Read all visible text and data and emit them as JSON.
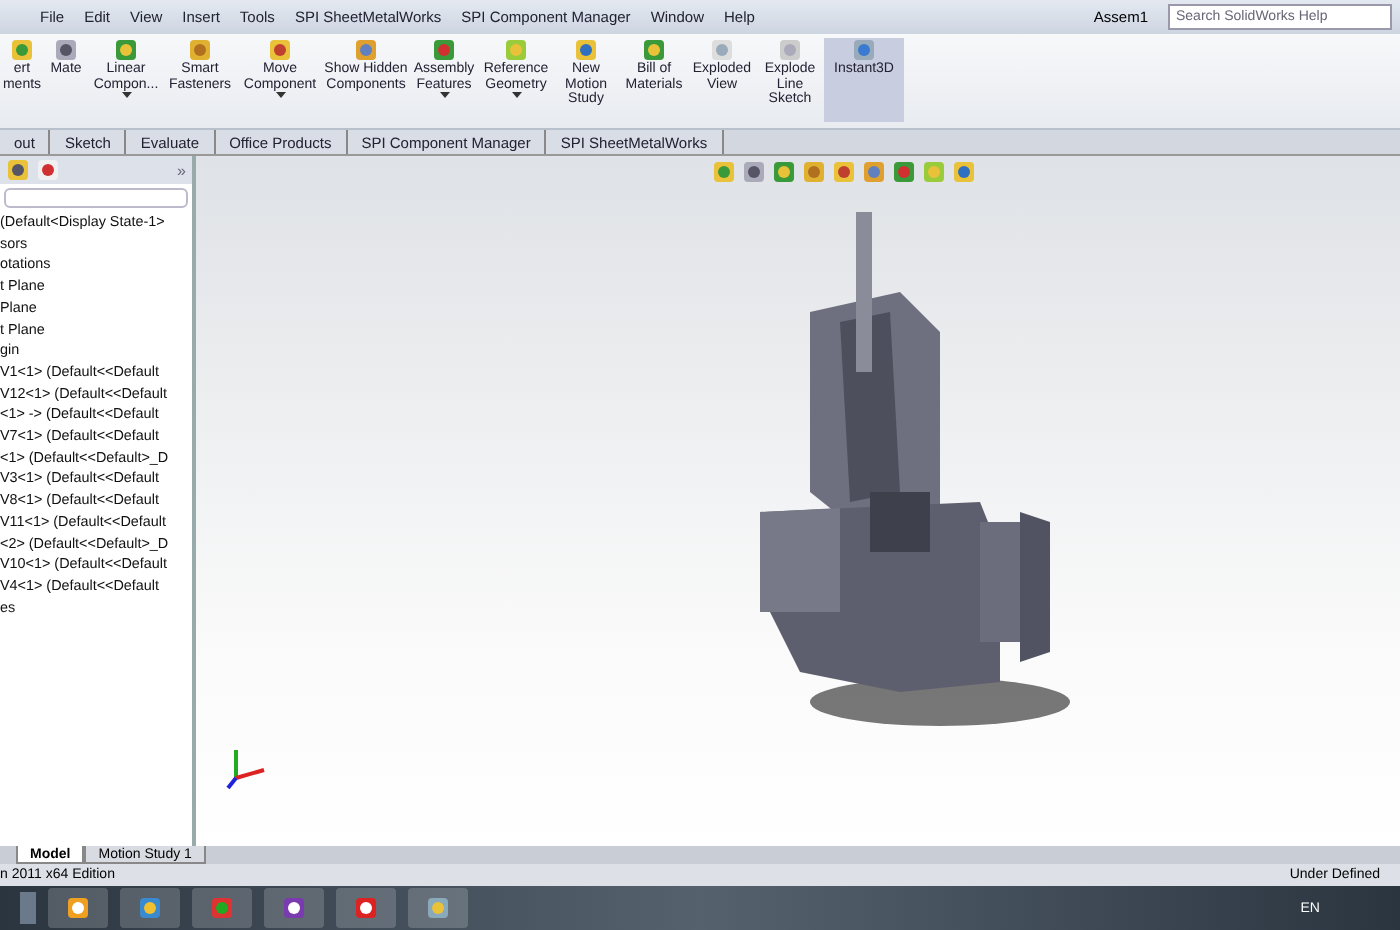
{
  "menu_bar": {
    "items": [
      "File",
      "Edit",
      "View",
      "Insert",
      "Tools",
      "SPI SheetMetalWorks",
      "SPI Component Manager",
      "Window",
      "Help"
    ],
    "document_title": "Assem1",
    "search": {
      "placeholder": "Search SolidWorks Help"
    }
  },
  "command_manager": {
    "buttons": [
      {
        "label": "ert ments",
        "dropdown": false
      },
      {
        "label": "Mate",
        "dropdown": false
      },
      {
        "label": "Linear Compon...",
        "dropdown": true
      },
      {
        "label": "Smart Fasteners",
        "dropdown": false
      },
      {
        "label": "Move Component",
        "dropdown": true
      },
      {
        "label": "Show Hidden Components",
        "dropdown": false
      },
      {
        "label": "Assembly Features",
        "dropdown": true
      },
      {
        "label": "Reference Geometry",
        "dropdown": true
      },
      {
        "label": "New Motion Study",
        "dropdown": false
      },
      {
        "label": "Bill of Materials",
        "dropdown": false
      },
      {
        "label": "Exploded View",
        "dropdown": false
      },
      {
        "label": "Explode Line Sketch",
        "dropdown": false
      },
      {
        "label": "Instant3D",
        "dropdown": false
      }
    ]
  },
  "tabs": [
    {
      "label": "out",
      "selected": false
    },
    {
      "label": "Sketch",
      "selected": false
    },
    {
      "label": "Evaluate",
      "selected": false
    },
    {
      "label": "Office Products",
      "selected": false
    },
    {
      "label": "SPI Component Manager",
      "selected": false
    },
    {
      "label": "SPI SheetMetalWorks",
      "selected": false
    }
  ],
  "feature_tree": {
    "panel_toggle": "»",
    "items": [
      "(Default<Display State-1>",
      "sors",
      "otations",
      "t Plane",
      "Plane",
      "t Plane",
      "gin",
      "V1<1> (Default<<Default",
      "V12<1> (Default<<Default",
      "<1> -> (Default<<Default",
      "V7<1> (Default<<Default",
      "<1> (Default<<Default>_D",
      "V3<1> (Default<<Default",
      "V8<1> (Default<<Default",
      "V11<1> (Default<<Default",
      "<2> (Default<<Default>_D",
      "V10<1> (Default<<Default",
      "V4<1> (Default<<Default",
      "es"
    ]
  },
  "bottom_tabs": [
    {
      "label": "Model",
      "selected": true
    },
    {
      "label": "Motion Study 1",
      "selected": false
    }
  ],
  "status_bar": {
    "left": "n 2011 x64 Edition",
    "right": "Under Defined"
  },
  "taskbar": {
    "language": "EN"
  }
}
